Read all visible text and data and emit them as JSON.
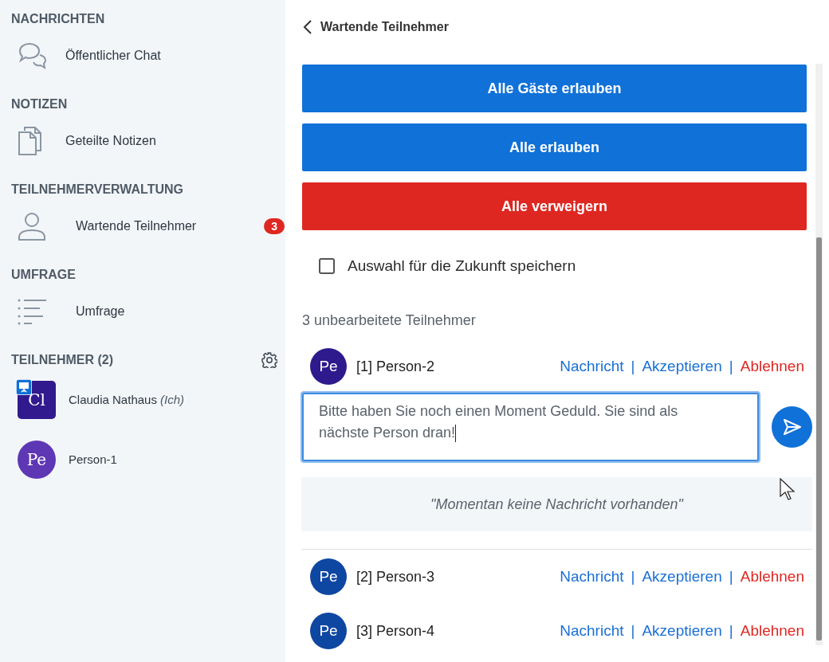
{
  "sidebar": {
    "sections": [
      {
        "heading": "NACHRICHTEN",
        "items": [
          {
            "kind": "chat",
            "label": "Öffentlicher Chat"
          }
        ]
      },
      {
        "heading": "NOTIZEN",
        "items": [
          {
            "kind": "notes",
            "label": "Geteilte Notizen"
          }
        ]
      },
      {
        "heading": "TEILNEHMERVERWALTUNG",
        "items": [
          {
            "kind": "user",
            "label": "Wartende Teilnehmer",
            "badge": "3"
          }
        ]
      },
      {
        "heading": "UMFRAGE",
        "items": [
          {
            "kind": "poll",
            "label": "Umfrage"
          }
        ]
      }
    ],
    "participants": {
      "heading": "TEILNEHMER (2)",
      "users": [
        {
          "initials": "Cl",
          "name": "Claudia Nathaus",
          "you_label": "(Ich)",
          "kind": "moderator",
          "presenter": true,
          "color": "#301a8e"
        },
        {
          "initials": "Pe",
          "name": "Person-1",
          "kind": "viewer",
          "presenter": false,
          "color": "#5e37b5"
        }
      ]
    }
  },
  "panel": {
    "title": "Wartende Teilnehmer",
    "buttons": [
      {
        "label": "Alle Gäste erlauben",
        "kind": "allow"
      },
      {
        "label": "Alle erlauben",
        "kind": "allow"
      },
      {
        "label": "Alle verweigern",
        "kind": "deny"
      }
    ],
    "remember": {
      "label": "Auswahl für die Zukunft speichern",
      "checked": false
    },
    "count": "3 unbearbeitete Teilnehmer",
    "guests": [
      {
        "initials": "Pe",
        "name": "[1] Person-2",
        "color": "#2e1a8c",
        "expanded": true,
        "message": "Bitte haben Sie noch einen Moment Geduld. Sie sind als nächste Person dran!",
        "no_messages": "\"Momentan keine Nachricht vorhanden\"",
        "actions": [
          {
            "kind": "message",
            "label": "Nachricht"
          },
          {
            "kind": "separator",
            "label": "|"
          },
          {
            "kind": "accept",
            "label": "Akzeptieren"
          },
          {
            "kind": "separator",
            "label": "|"
          },
          {
            "kind": "deny",
            "label": "Ablehnen"
          }
        ]
      },
      {
        "initials": "Pe",
        "name": "[2] Person-3",
        "color": "#0e47a1",
        "expanded": false,
        "actions": [
          {
            "kind": "message",
            "label": "Nachricht"
          },
          {
            "kind": "separator",
            "label": "|"
          },
          {
            "kind": "accept",
            "label": "Akzeptieren"
          },
          {
            "kind": "separator",
            "label": "|"
          },
          {
            "kind": "deny",
            "label": "Ablehnen"
          }
        ]
      },
      {
        "initials": "Pe",
        "name": "[3] Person-4",
        "color": "#0e47a1",
        "expanded": false,
        "actions": [
          {
            "kind": "message",
            "label": "Nachricht"
          },
          {
            "kind": "separator",
            "label": "|"
          },
          {
            "kind": "accept",
            "label": "Akzeptieren"
          },
          {
            "kind": "separator",
            "label": "|"
          },
          {
            "kind": "deny",
            "label": "Ablehnen"
          }
        ]
      }
    ]
  }
}
